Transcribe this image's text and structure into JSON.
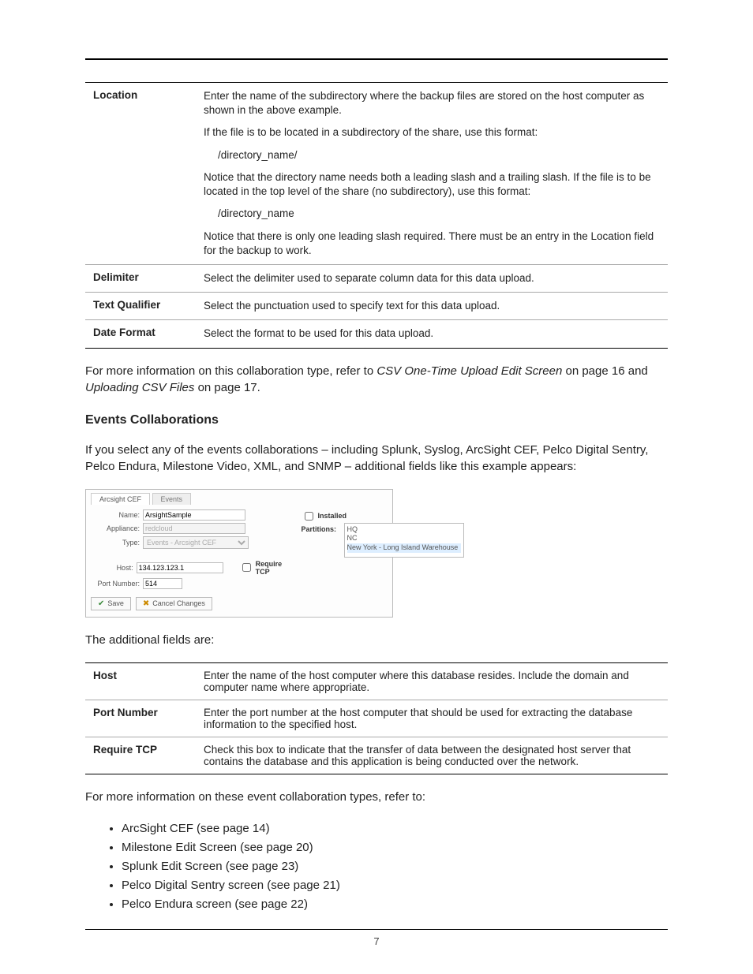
{
  "table1": {
    "rows": [
      {
        "label": "Location",
        "paragraphs": [
          "Enter the name of the subdirectory where the backup files are stored on the host computer as shown in the above example.",
          "If the file is to be located in a subdirectory of the share, use this format:",
          "/directory_name/",
          "Notice that the directory name needs both a leading slash and a trailing slash. If the file is to be located in the top level of the share (no subdirectory), use this format:",
          "/directory_name",
          "Notice that there is only one leading slash required. There must be an entry in the Location field for the backup to work."
        ],
        "indent_idx": [
          2,
          4
        ]
      },
      {
        "label": "Delimiter",
        "paragraphs": [
          "Select the delimiter used to separate column data for this data upload."
        ],
        "indent_idx": []
      },
      {
        "label": "Text Qualifier",
        "paragraphs": [
          "Select the punctuation used to specify text for this data upload."
        ],
        "indent_idx": []
      },
      {
        "label": "Date Format",
        "paragraphs": [
          "Select the format to be used for this data upload."
        ],
        "indent_idx": []
      }
    ]
  },
  "para_after_table1": {
    "pre": "For more information on this collaboration type, refer to ",
    "em1": "CSV One-Time Upload Edit Screen",
    "mid": " on page 16 and ",
    "em2": "Uploading CSV Files",
    "post": " on page 17."
  },
  "heading_events": "Events Collaborations",
  "para_events_intro": "If you select any of the events collaborations – including Splunk, Syslog, ArcSight CEF, Pelco Digital Sentry, Pelco Endura, Milestone Video, XML, and SNMP – additional fields like this example appears:",
  "figure": {
    "tabs": {
      "active": "Arcsight CEF",
      "inactive": "Events"
    },
    "fields": {
      "name_label": "Name:",
      "name_value": "ArsightSample",
      "appliance_label": "Appliance:",
      "appliance_value": "redcloud",
      "type_label": "Type:",
      "type_value": "Events - Arcsight CEF",
      "installed_label": "Installed",
      "partitions_label": "Partitions:",
      "partitions_items": [
        "HQ",
        "NC",
        "New York - Long Island Warehouse"
      ],
      "host_label": "Host:",
      "host_value": "134.123.123.1",
      "require_tcp_label": "Require TCP",
      "port_label": "Port Number:",
      "port_value": "514"
    },
    "buttons": {
      "save": "Save",
      "cancel": "Cancel Changes"
    }
  },
  "para_additional_fields": "The additional fields are:",
  "table2": {
    "rows": [
      {
        "label": "Host",
        "desc": "Enter the name of the host computer where this database resides. Include the domain and computer name where appropriate."
      },
      {
        "label": "Port Number",
        "desc": "Enter the port number at the host computer that should be used for extracting the database information to the specified host."
      },
      {
        "label": "Require TCP",
        "desc": "Check this box to indicate that the transfer of data between the designated host server that contains the database and this application is being conducted over the network."
      }
    ]
  },
  "para_refer": "For more information on these event collaboration types, refer to:",
  "ref_list": [
    "ArcSight CEF (see page 14)",
    "Milestone Edit Screen (see page 20)",
    "Splunk Edit Screen (see page 23)",
    "Pelco Digital Sentry screen (see page 21)",
    "Pelco Endura screen (see page 22)"
  ],
  "page_number": "7"
}
